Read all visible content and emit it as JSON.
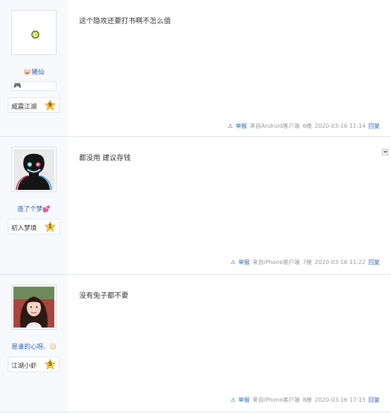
{
  "posts": [
    {
      "username": "猪仙",
      "username_prefix_icon": "pig-face-icon",
      "badge_icon": "game-controller-icon",
      "level_name": "威震江湖",
      "level": "9",
      "content": "这个隐攻还要打书啊不怎么值",
      "report_label": "举报",
      "client": "来自Android客户端",
      "floor": "6楼",
      "time": "2020-03-16 11:14",
      "reply_label": "回复"
    },
    {
      "username": "造了个梦",
      "username_suffix_icon": "pink-hearts-icon",
      "level_name": "初入梦境",
      "level": "1",
      "content": "都没用 建议存钱",
      "report_label": "举报",
      "client": "来自iPhone客户端",
      "floor": "7楼",
      "time": "2020-03-16 11:22",
      "reply_label": "回复"
    },
    {
      "username": "是谁的心呀、",
      "username_suffix_icon": "emoji-face-icon",
      "level_name": "江湖小虾",
      "level": "5",
      "content": "没有兔子都不要",
      "report_label": "举报",
      "client": "来自iPhone客户端",
      "floor": "8楼",
      "time": "2020-03-16 17:15",
      "reply_label": "回复"
    }
  ],
  "colors": {
    "link": "#2d64b3",
    "meta": "#999999",
    "left_panel": "#f7f9fd",
    "star": "#f5c53c"
  }
}
